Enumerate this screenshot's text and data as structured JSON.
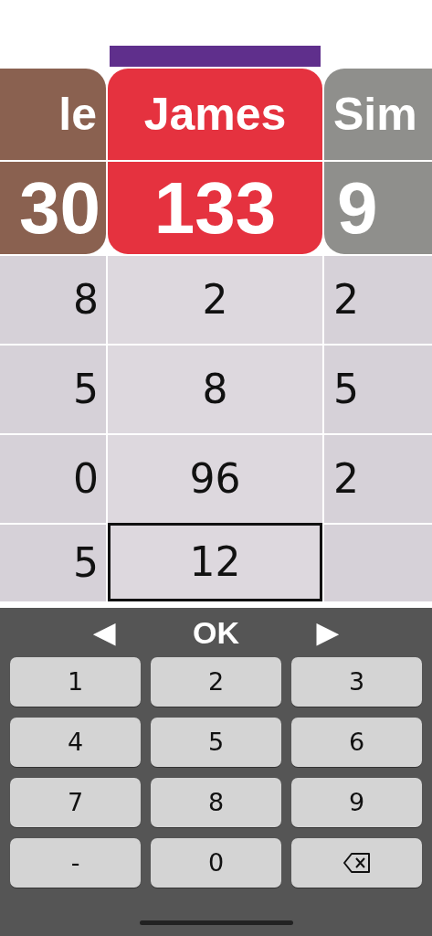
{
  "players": [
    {
      "name": "le",
      "score": "30",
      "color": "#8a6150",
      "selected": false
    },
    {
      "name": "James",
      "score": "133",
      "color": "#e5323f",
      "selected": true
    },
    {
      "name": "Sim",
      "score": "9",
      "color": "#8f8f8c",
      "selected": false
    }
  ],
  "rows": [
    {
      "cells": [
        {
          "value": "8",
          "selected": false
        },
        {
          "value": "2",
          "selected": false
        },
        {
          "value": "2",
          "selected": false
        }
      ]
    },
    {
      "cells": [
        {
          "value": "5",
          "selected": false
        },
        {
          "value": "8",
          "selected": false
        },
        {
          "value": "5",
          "selected": false
        }
      ]
    },
    {
      "cells": [
        {
          "value": "0",
          "selected": false
        },
        {
          "value": "96",
          "selected": false
        },
        {
          "value": "2",
          "selected": false
        }
      ]
    },
    {
      "cells": [
        {
          "value": "5",
          "selected": false
        },
        {
          "value": "12",
          "selected": true
        },
        {
          "selected": false
        }
      ]
    }
  ],
  "keypad": {
    "prev": "◀",
    "ok": "OK",
    "next": "▶",
    "keys": [
      {
        "kind": "digit",
        "label": "1"
      },
      {
        "kind": "digit",
        "label": "2"
      },
      {
        "kind": "digit",
        "label": "3"
      },
      {
        "kind": "digit",
        "label": "4"
      },
      {
        "kind": "digit",
        "label": "5"
      },
      {
        "kind": "digit",
        "label": "6"
      },
      {
        "kind": "digit",
        "label": "7"
      },
      {
        "kind": "digit",
        "label": "8"
      },
      {
        "kind": "digit",
        "label": "9"
      },
      {
        "kind": "digit",
        "label": "-"
      },
      {
        "kind": "digit",
        "label": "0"
      },
      {
        "kind": "backspace"
      }
    ]
  }
}
